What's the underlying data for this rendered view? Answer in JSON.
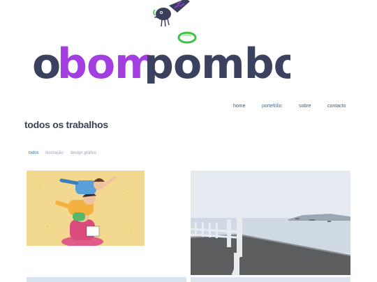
{
  "brand": {
    "logo_text": "obompombo",
    "colors": {
      "dark": "#3b4260",
      "accent": "#a33fe0",
      "leaf": "#43c343"
    }
  },
  "nav": {
    "items": [
      {
        "label": "home",
        "active": false
      },
      {
        "label": "portefólio",
        "active": true
      },
      {
        "label": "sobre",
        "active": false
      },
      {
        "label": "contacto",
        "active": false
      }
    ],
    "active_color": "#2f6fa8"
  },
  "page": {
    "title": "todos os trabalhos"
  },
  "filters": {
    "items": [
      {
        "label": "todos",
        "active": true
      },
      {
        "label": "ilustração",
        "active": false
      },
      {
        "label": "design gráfico",
        "active": false
      }
    ]
  },
  "gallery": {
    "items": [
      {
        "name": "illustration-stacked-kids"
      },
      {
        "name": "photo-seaside-pier"
      },
      {
        "name": "thumbnail-3"
      },
      {
        "name": "thumbnail-4"
      }
    ]
  }
}
